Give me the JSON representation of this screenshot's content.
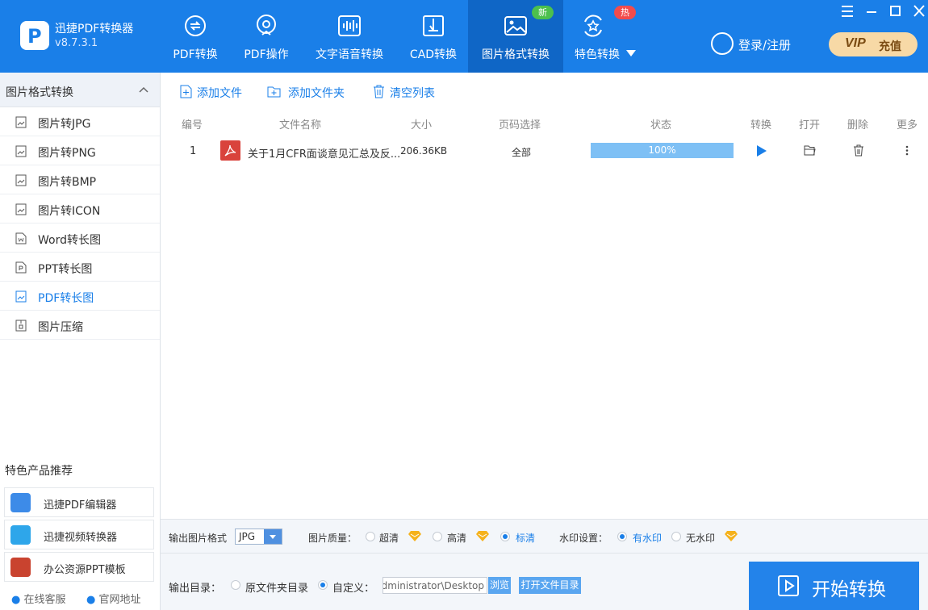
{
  "app": {
    "name": "迅捷PDF转换器",
    "version": "v8.7.3.1"
  },
  "nav": [
    {
      "label": "PDF转换",
      "icon": "convert-icon"
    },
    {
      "label": "PDF操作",
      "icon": "operate-icon"
    },
    {
      "label": "文字语音转换",
      "icon": "audio-wave-icon"
    },
    {
      "label": "CAD转换",
      "icon": "cad-icon"
    },
    {
      "label": "图片格式转换",
      "icon": "image-icon",
      "badge": "新"
    },
    {
      "label": "特色转换",
      "icon": "star-refresh-icon",
      "badge": "热"
    }
  ],
  "header": {
    "login": "登录/注册",
    "vip_a": "VIP",
    "vip_b": "充值"
  },
  "sidebar": {
    "title": "图片格式转换",
    "items": [
      {
        "label": "图片转JPG"
      },
      {
        "label": "图片转PNG"
      },
      {
        "label": "图片转BMP"
      },
      {
        "label": "图片转ICON"
      },
      {
        "label": "Word转长图"
      },
      {
        "label": "PPT转长图"
      },
      {
        "label": "PDF转长图",
        "active": true
      },
      {
        "label": "图片压缩"
      }
    ],
    "rec_title": "特色产品推荐",
    "recs": [
      {
        "label": "迅捷PDF编辑器"
      },
      {
        "label": "迅捷视频转换器"
      },
      {
        "label": "办公资源PPT模板"
      }
    ],
    "footer": {
      "service": "在线客服",
      "site": "官网地址"
    }
  },
  "toolbar": {
    "add_file": "添加文件",
    "add_folder": "添加文件夹",
    "clear": "清空列表"
  },
  "table": {
    "headers": [
      "编号",
      "文件名称",
      "大小",
      "页码选择",
      "状态",
      "转换",
      "打开",
      "删除",
      "更多"
    ],
    "rows": [
      {
        "no": "1",
        "name": "关于1月CFR面谈意见汇总及反...",
        "size": "206.36KB",
        "pages": "全部",
        "progress_label": "100%",
        "progress": 100
      }
    ]
  },
  "settings": {
    "format_label": "输出图片格式",
    "format_value": "JPG",
    "quality_label": "图片质量：",
    "quality_options": [
      "超清",
      "高清",
      "标清"
    ],
    "watermark_label": "水印设置：",
    "watermark_options": [
      "有水印",
      "无水印"
    ],
    "output_label": "输出目录：",
    "output_options": [
      "原文件夹目录",
      "自定义："
    ],
    "path": "dministrator\\Desktop",
    "browse": "浏览",
    "open_dir": "打开文件目录",
    "start": "开始转换"
  },
  "colors": {
    "primary": "#1a7fe8",
    "nav_active": "#0f66c6",
    "badge_new": "#4cc04d",
    "badge_hot": "#f24b4b",
    "vip": "#f7d9a6",
    "gold": "#f5b21c"
  }
}
